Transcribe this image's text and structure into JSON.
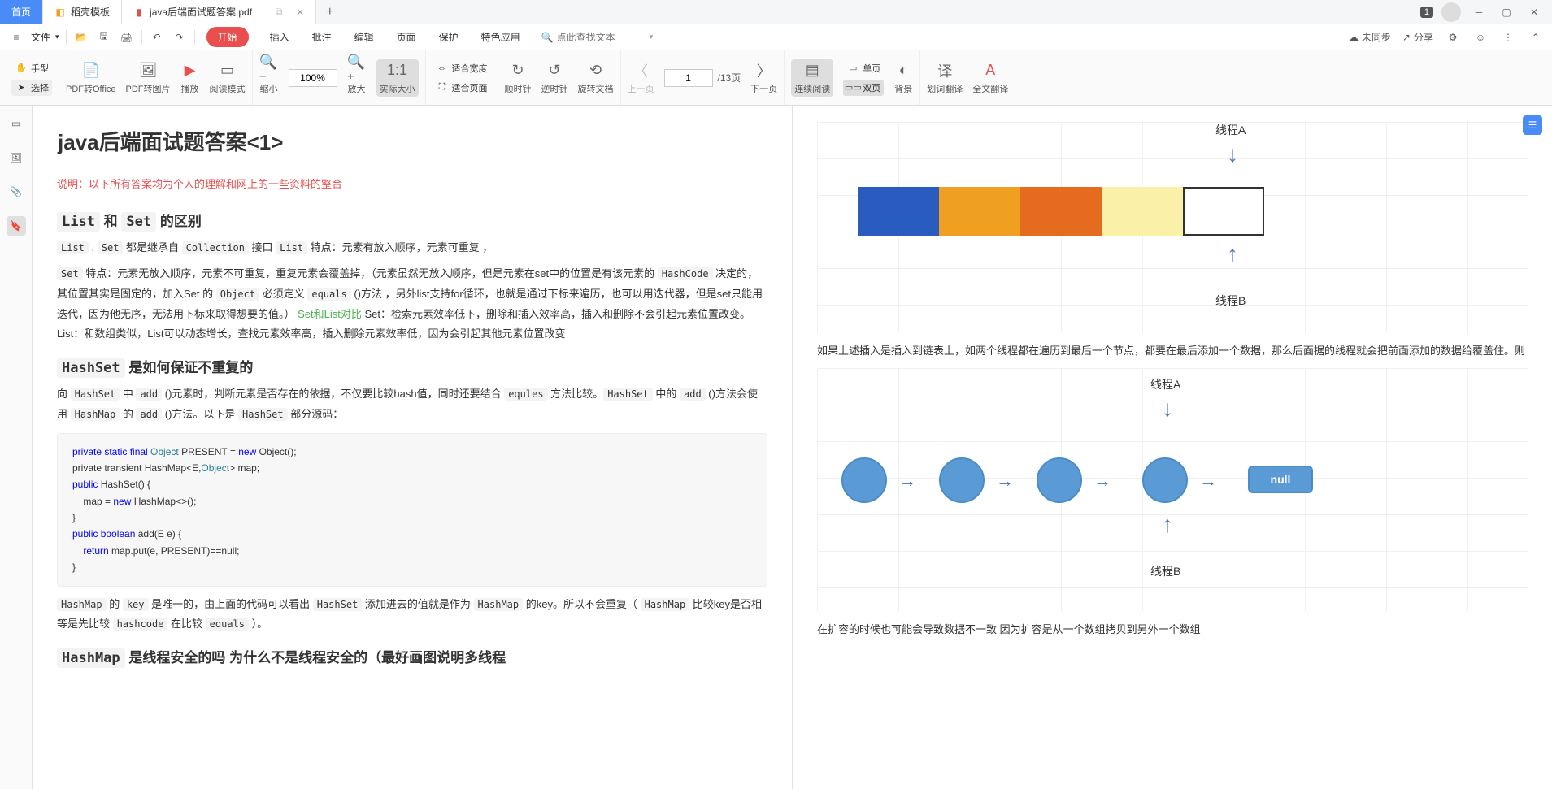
{
  "tabs": {
    "home": "首页",
    "template": "稻壳模板",
    "doc": "java后端面试题答案.pdf"
  },
  "badge": "1",
  "file_label": "文件",
  "menus": {
    "start": "开始",
    "insert": "插入",
    "annotate": "批注",
    "edit": "编辑",
    "page": "页面",
    "protect": "保护",
    "special": "特色应用"
  },
  "search_placeholder": "点此查找文本",
  "sync": "未同步",
  "share": "分享",
  "toolbar": {
    "hand": "手型",
    "select": "选择",
    "pdf2office": "PDF转Office",
    "pdf2img": "PDF转图片",
    "play": "播放",
    "readmode": "阅读模式",
    "zoomout": "缩小",
    "zoom": "100%",
    "zoomin": "放大",
    "actualsize": "实际大小",
    "fitwidth": "适合宽度",
    "fitpage": "适合页面",
    "cw": "顺时针",
    "ccw": "逆时针",
    "rotate": "旋转文档",
    "prevpage": "上一页",
    "curpage": "1",
    "totalpage": "/13页",
    "nextpage": "下一页",
    "continuous": "连续阅读",
    "singlepage": "单页",
    "doublepage": "双页",
    "background": "背景",
    "wordtrans": "划词翻译",
    "fulltrans": "全文翻译"
  },
  "doc": {
    "h1": "java后端面试题答案<1>",
    "note": "说明：以下所有答案均为个人的理解和网上的一些资料的整合",
    "h2_1a": "List",
    "h2_1b": " 和 ",
    "h2_1c": "Set",
    "h2_1d": " 的区别",
    "p1a": "List",
    "p1b": " , ",
    "p1c": "Set",
    "p1d": " 都是继承自 ",
    "p1e": "Collection",
    "p1f": " 接口 ",
    "p1g": "List",
    "p1h": " 特点：元素有放入顺序，元素可重复 ，",
    "p2a": "Set",
    "p2b": " 特点：元素无放入顺序，元素不可重复，重复元素会覆盖掉，（元素虽然无放入顺序，但是元素在set中的位置是有该元素的 ",
    "p2c": "HashCode",
    "p2d": " 决定的，其位置其实是固定的，加入Set 的 ",
    "p2e": "Object",
    "p2f": " 必须定义 ",
    "p2g": "equals",
    "p2h": " ()方法 ，另外list支持for循环，也就是通过下标来遍历，也可以用迭代器，但是set只能用迭代，因为他无序，无法用下标来取得想要的值。） ",
    "p2i": "Set和List对比",
    "p2j": " Set：检索元素效率低下，删除和插入效率高，插入和删除不会引起元素位置改变。 List：和数组类似，List可以动态增长，查找元素效率高，插入删除元素效率低，因为会引起其他元素位置改变",
    "h3a": "HashSet",
    "h3b": " 是如何保证不重复的",
    "p3a": "向 ",
    "p3b": "HashSet",
    "p3c": " 中 ",
    "p3d": "add",
    "p3e": " ()元素时，判断元素是否存在的依据，不仅要比较hash值，同时还要结合 ",
    "p3f": "equles",
    "p3g": " 方法比较。",
    "p3h": "HashSet",
    "p3i": " 中的 ",
    "p3j": "add",
    "p3k": " ()方法会使用 ",
    "p3l": "HashMap",
    "p3m": " 的 ",
    "p3n": "add",
    "p3o": " ()方法。以下是 ",
    "p3p": "HashSet",
    "p3q": " 部分源码：",
    "code1": "private static final",
    "code2": " Object ",
    "code3": "PRESENT = ",
    "code4": "new",
    "code5": " Object();\nprivate transient ",
    "code6": "HashMap<E,",
    "code7": "Object",
    "code8": "> map;\n",
    "code9": "public",
    "code10": " HashSet() {\n    map = ",
    "code11": "new",
    "code12": " HashMap<>();\n}\n",
    "code13": "public boolean",
    "code14": " add(E e) {\n    ",
    "code15": "return",
    "code16": " map.put(e, PRESENT)==null;\n}",
    "p4a": "HashMap",
    "p4b": " 的 ",
    "p4c": "key",
    "p4d": " 是唯一的，由上面的代码可以看出 ",
    "p4e": "HashSet",
    "p4f": " 添加进去的值就是作为 ",
    "p4g": "HashMap",
    "p4h": " 的key。所以不会重复（ ",
    "p4i": "HashMap",
    "p4j": " 比较key是否相等是先比较 ",
    "p4k": "hashcode",
    "p4l": " 在比较 ",
    "p4m": "equals",
    "p4n": " ）。",
    "h4a": "HashMap",
    "h4b": " 是线程安全的吗   为什么不是线程安全的（最好画图说明多线程"
  },
  "right": {
    "threadA": "线程A",
    "threadB": "线程B",
    "desc": "如果上述插入是插入到链表上，如两个线程都在遍历到最后一个节点，都要在最后添加一个数据，那么后面据的线程就会把前面添加的数据给覆盖住。则",
    "null": "null",
    "footer": "在扩容的时候也可能会导致数据不一致   因为扩容是从一个数组拷贝到另外一个数组"
  }
}
